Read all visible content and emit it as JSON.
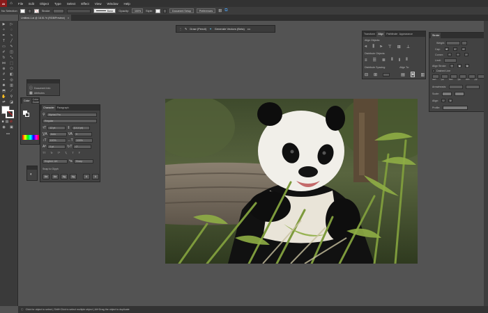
{
  "menubar": {
    "app": "Ai",
    "items": [
      "File",
      "Edit",
      "Object",
      "Type",
      "Select",
      "Effect",
      "View",
      "Window",
      "Help"
    ]
  },
  "control": {
    "selection": "No Selection",
    "stroke_label": "Stroke:",
    "brush_value": "Basic",
    "opacity_label": "Opacity:",
    "opacity_value": "100%",
    "style_label": "Style:",
    "document_setup": "Document Setup",
    "preferences": "Preferences"
  },
  "doc_tab": {
    "title": "Untitled-1.ai @ 18.51 % (RGB/Preview)",
    "close": "×"
  },
  "context_bar": {
    "draw": "Draw (Pencil)",
    "generate": "Generate Vectors (Beta)",
    "more": "•••"
  },
  "doc_info_panel": {
    "items": [
      "Document Info",
      "Attributes"
    ]
  },
  "color_panel": {
    "tabs": [
      "Color",
      "Color Guide"
    ]
  },
  "character_panel": {
    "tabs": [
      "Character",
      "Paragraph"
    ],
    "font_family": "Myriad Pro",
    "font_style": "Regular",
    "size": "12 pt",
    "leading": "(14.4 pt)",
    "kerning": "Auto",
    "tracking": "0",
    "vscale": "100%",
    "hscale": "100%",
    "baseline": "0 pt",
    "rotation": "0°",
    "language": "English: UK",
    "aa": "Sharp",
    "snap_label": "Snap to Glyph",
    "type_buttons": [
      "TT",
      "Tr",
      "T¹",
      "T₁",
      "T",
      "Ŧ"
    ],
    "snap_buttons": [
      "Aa",
      "Aa",
      "Ag",
      "Ag",
      "A",
      "A"
    ]
  },
  "align_panel": {
    "tabs": [
      "Transform",
      "Align",
      "Pathfinder",
      "Appearance"
    ],
    "align_objects": "Align Objects:",
    "distribute_objects": "Distribute Objects:",
    "distribute_spacing": "Distribute Spacing:",
    "align_to": "Align To:"
  },
  "stroke_panel": {
    "tab": "Stroke",
    "weight_label": "Weight:",
    "cap_label": "Cap:",
    "corner_label": "Corner:",
    "limit_label": "Limit:",
    "align_label": "Align Stroke:",
    "dashed_label": "Dashed Line",
    "dash_labels": [
      "dash",
      "gap",
      "dash",
      "gap",
      "dash",
      "gap"
    ],
    "arrowheads_label": "Arrowheads:",
    "scale_label": "Scale:",
    "align2_label": "Align:",
    "profile_label": "Profile:"
  },
  "statusbar": {
    "hint": "Click for object to select  |  Shift+Click to select multiple object  |  Alt+Drag the object to duplicate"
  },
  "colors": {
    "ui_bg": "#535353",
    "panel": "#424242",
    "accent_blue": "#2f7fd6"
  }
}
